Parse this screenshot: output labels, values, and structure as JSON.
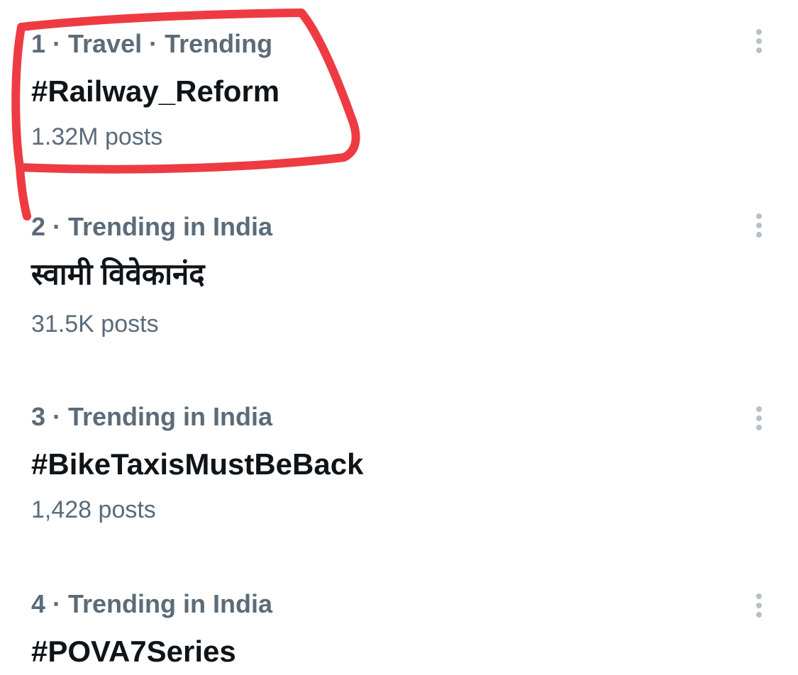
{
  "trends": [
    {
      "meta": "1 · Travel · Trending",
      "title": "#Railway_Reform",
      "posts": "1.32M posts"
    },
    {
      "meta": "2 · Trending in India",
      "title": "स्वामी विवेकानंद",
      "posts": "31.5K posts"
    },
    {
      "meta": "3 · Trending in India",
      "title": "#BikeTaxisMustBeBack",
      "posts": "1,428 posts"
    },
    {
      "meta": "4 · Trending in India",
      "title": "#POVA7Series",
      "posts": ""
    }
  ],
  "icons": {
    "more": "more-vertical-icon"
  },
  "colors": {
    "annotation": "#ee3b43",
    "title_text": "#0f1419",
    "secondary_text": "#5b6b79",
    "icon": "#b7c0c8"
  }
}
